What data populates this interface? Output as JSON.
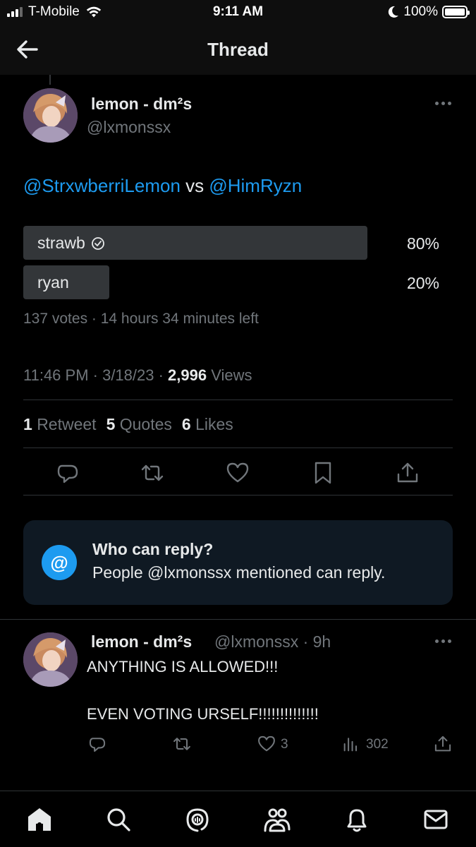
{
  "status_bar": {
    "carrier": "T-Mobile",
    "time": "9:11 AM",
    "battery": "100%"
  },
  "header": {
    "title": "Thread"
  },
  "tweet": {
    "name": "lemon - dm²s",
    "handle": "@lxmonssx",
    "mention1": "@StrxwberriLemon",
    "vs": " vs ",
    "mention2": "@HimRyzn",
    "poll": {
      "options": [
        {
          "label": "strawb",
          "percent_label": "80%",
          "percent": 80,
          "winner": true
        },
        {
          "label": "ryan",
          "percent_label": "20%",
          "percent": 20,
          "winner": false
        }
      ],
      "meta": "137 votes · 14 hours 34 minutes left"
    },
    "timestamp": "11:46 PM · 3/18/23 · ",
    "views_count": "2,996",
    "views_label": " Views",
    "stats": {
      "retweets_count": "1",
      "retweets_label": "Retweet",
      "quotes_count": "5",
      "quotes_label": "Quotes",
      "likes_count": "6",
      "likes_label": "Likes"
    }
  },
  "who_can_reply": {
    "icon": "@",
    "title": "Who can reply?",
    "body": "People @lxmonssx mentioned can reply."
  },
  "reply": {
    "name": "lemon - dm²s",
    "handle_time": "@lxmonssx · 9h",
    "line1": "ANYTHING IS ALLOWED!!!",
    "line2": "EVEN VOTING URSELF!!!!!!!!!!!!!!",
    "likes": "3",
    "views": "302"
  },
  "icons": [
    "back-arrow-icon",
    "more-icon",
    "check-circle-icon",
    "reply-icon",
    "retweet-icon",
    "like-icon",
    "bookmark-icon",
    "share-icon",
    "views-icon",
    "home-icon",
    "search-icon",
    "spaces-icon",
    "communities-icon",
    "notifications-icon",
    "messages-icon"
  ],
  "colors": {
    "accent": "#1d9bf0",
    "background": "#000000",
    "muted": "#71767b",
    "card": "#0f1923"
  }
}
